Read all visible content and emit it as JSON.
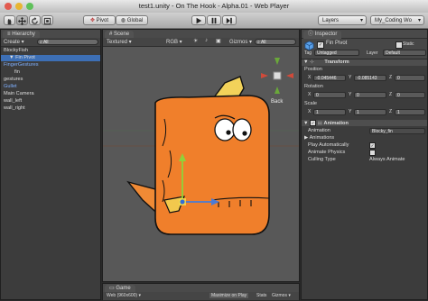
{
  "window": {
    "title": "test1.unity - On The Hook - Alpha.01 - Web Player",
    "colors": {
      "close": "#e25b4f",
      "minimize": "#e8b532",
      "zoom": "#5fc15a",
      "accent": "#3d7bd8"
    }
  },
  "toolbar": {
    "pivot_label": "Pivot",
    "global_label": "Global",
    "layers_label": "Layers",
    "layout_label": "My_Coding Wo"
  },
  "hierarchy": {
    "tab_label": "Hierarchy",
    "create_label": "Create",
    "search_placeholder": "All",
    "items": [
      {
        "label": "BlockyFish",
        "indent": 0,
        "selected": false,
        "color": "white"
      },
      {
        "label": "Fin Pivot",
        "indent": 1,
        "selected": true,
        "color": "white"
      },
      {
        "label": "FingerGestures",
        "indent": 0,
        "selected": false,
        "color": "blue"
      },
      {
        "label": "fin",
        "indent": 2,
        "selected": false,
        "color": "white"
      },
      {
        "label": "gestures",
        "indent": 0,
        "selected": false,
        "color": "white"
      },
      {
        "label": "Gullet",
        "indent": 0,
        "selected": false,
        "color": "blue"
      },
      {
        "label": "Main Camera",
        "indent": 0,
        "selected": false,
        "color": "white"
      },
      {
        "label": "wall_left",
        "indent": 0,
        "selected": false,
        "color": "white"
      },
      {
        "label": "wall_right",
        "indent": 0,
        "selected": false,
        "color": "white"
      }
    ]
  },
  "scene": {
    "tab_label": "Scene",
    "shading_mode": "Textured",
    "render_mode": "RGB",
    "gizmos_label": "Gizmos",
    "search_placeholder": "All",
    "gizmo_view_label": "Back"
  },
  "game": {
    "tab_label": "Game",
    "resolution": "Web (960x600)",
    "maximize_label": "Maximize on Play",
    "stats_label": "Stats",
    "gizmos_label": "Gizmos"
  },
  "inspector": {
    "tab_label": "Inspector",
    "object_name": "Fin Pivot",
    "static_label": "Static",
    "tag_label": "Tag",
    "tag_value": "Untagged",
    "layer_label": "Layer",
    "layer_value": "Default",
    "transform": {
      "header": "Transform",
      "position_label": "Position",
      "position": {
        "x": "-0.045446",
        "y": "-0.085143",
        "z": "0"
      },
      "rotation_label": "Rotation",
      "rotation": {
        "x": "0",
        "y": "0",
        "z": "0"
      },
      "scale_label": "Scale",
      "scale": {
        "x": "1",
        "y": "1",
        "z": "1"
      }
    },
    "animation": {
      "header": "Animation",
      "animation_label": "Animation",
      "animation_value": "Blocky_fin",
      "animations_label": "Animations",
      "play_auto_label": "Play Automatically",
      "play_auto_checked": true,
      "animate_physics_label": "Animate Physics",
      "animate_physics_checked": false,
      "culling_label": "Culling Type",
      "culling_value": "Always Animate"
    }
  }
}
